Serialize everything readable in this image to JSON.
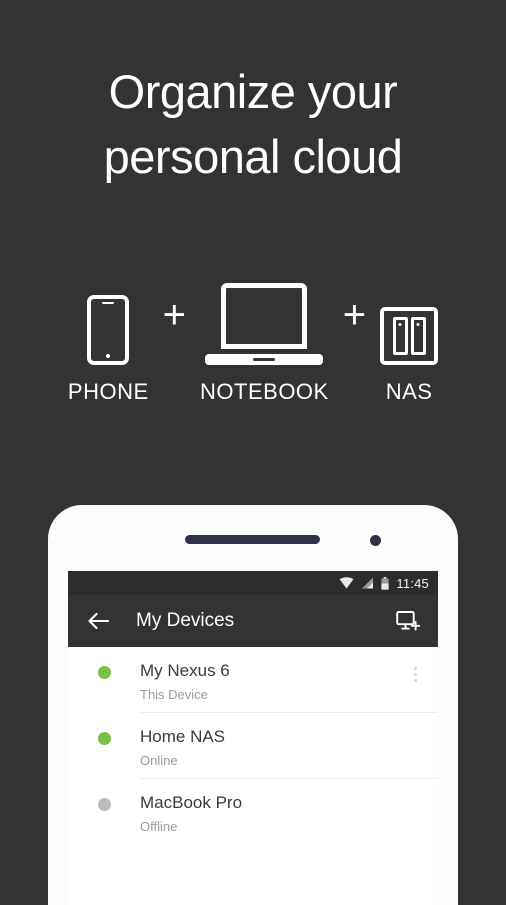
{
  "promo": {
    "headline_line1": "Organize your",
    "headline_line2": "personal cloud",
    "background_color": "#333333",
    "devices": [
      {
        "icon": "phone-icon",
        "label": "PHONE"
      },
      {
        "icon": "notebook-icon",
        "label": "NOTEBOOK"
      },
      {
        "icon": "nas-icon",
        "label": "NAS"
      }
    ],
    "separator": "+"
  },
  "phone_mockup": {
    "status_bar": {
      "wifi_icon": "wifi-icon",
      "signal_icon": "cellular-signal-icon",
      "battery_icon": "battery-icon",
      "time": "11:45"
    },
    "app_bar": {
      "back_icon": "back-arrow-icon",
      "title": "My Devices",
      "action_icon": "add-device-icon"
    },
    "device_list": [
      {
        "name": "My Nexus 6",
        "status": "This Device",
        "state": "online",
        "dot_color": "#78c043",
        "has_overflow": true,
        "overflow_icon": "overflow-menu-icon"
      },
      {
        "name": "Home NAS",
        "status": "Online",
        "state": "online",
        "dot_color": "#78c043",
        "has_overflow": false
      },
      {
        "name": "MacBook Pro",
        "status": "Offline",
        "state": "offline",
        "dot_color": "#bcbcbc",
        "has_overflow": false
      }
    ]
  }
}
